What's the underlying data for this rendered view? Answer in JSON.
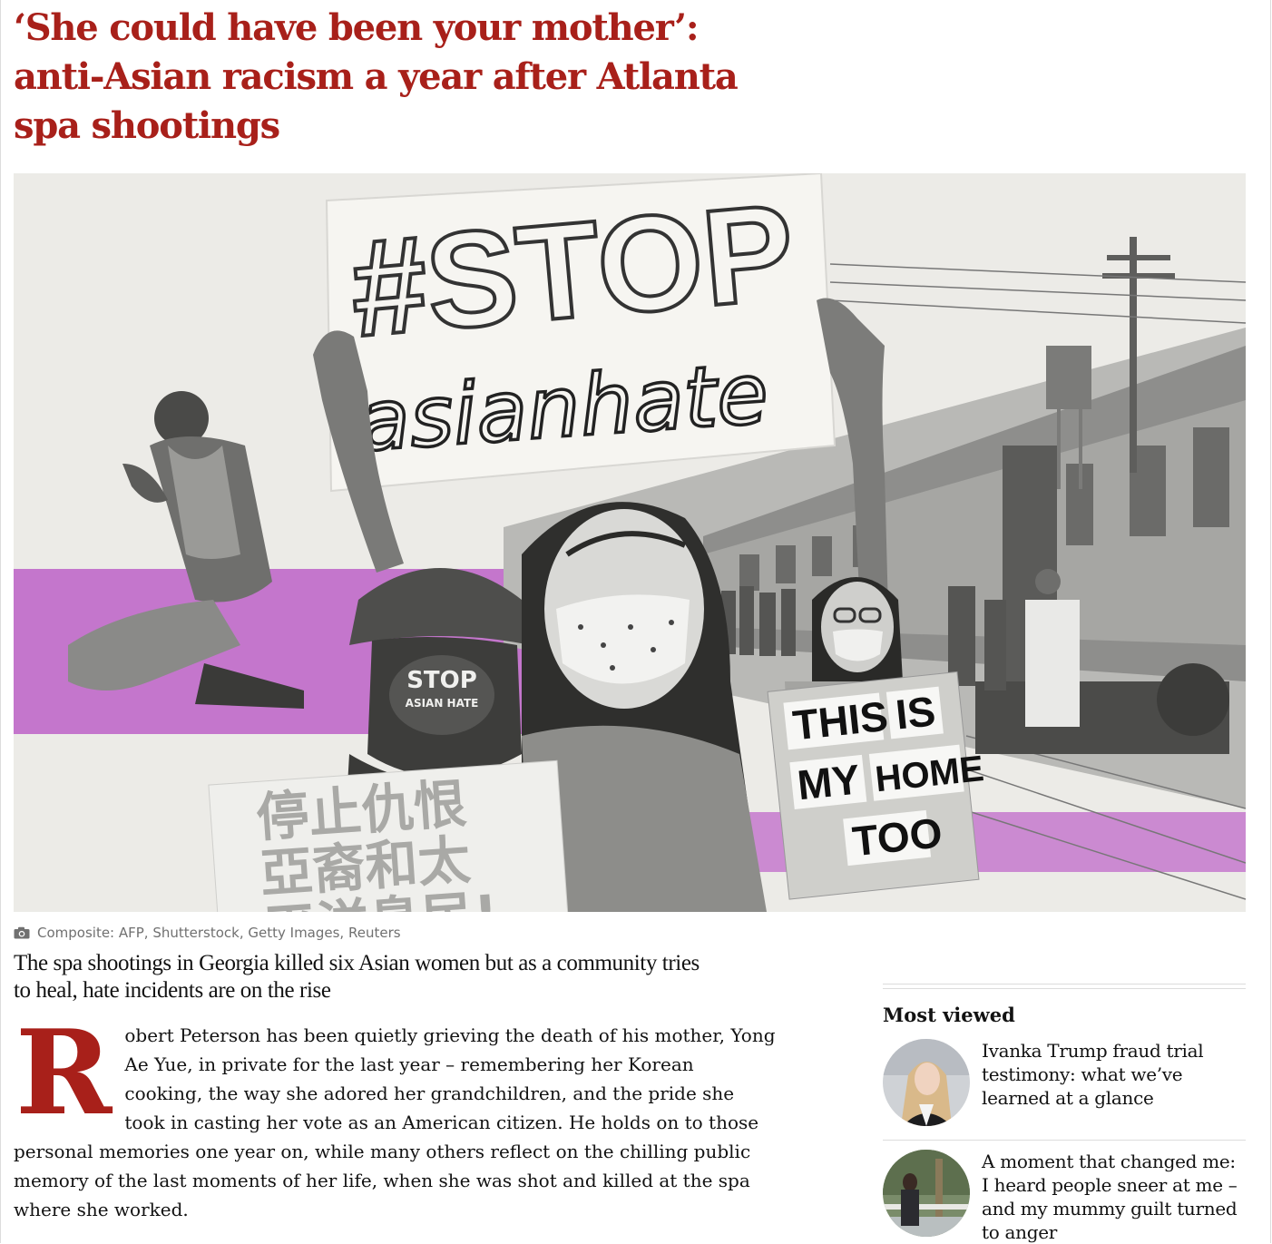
{
  "article": {
    "headline": "‘She could have been your mother’: anti-Asian racism a year after Atlanta spa shootings",
    "image_caption": "Composite: AFP, Shutterstock, Getty Images, Reuters",
    "standfirst": "The spa shootings in Georgia killed six Asian women but as a community tries to heal, hate incidents are on the rise",
    "drop_cap": "R",
    "first_paragraph": "obert Peterson has been quietly grieving the death of his mother, Yong Ae Yue, in private for the last year – remembering her Korean cooking, the way she adored her grandchildren, and the pride she took in casting her vote as an American citizen. He holds on to those personal memories one year on, while many others reflect on the chilling public memory of the last moments of her life, when she was shot and killed at the spa where she worked."
  },
  "hero_image": {
    "sign_top_line1": "#STOP",
    "sign_top_line2": "asianhate",
    "mask_line1": "STOP",
    "mask_line2": "ASIAN HATE",
    "sign_chinese_line1": "停止仇恨",
    "sign_chinese_line2": "亞裔和太",
    "sign_chinese_line3": "平洋島民!",
    "sign_right_words": [
      "THIS",
      "IS",
      "MY",
      "HOME",
      "TOO"
    ]
  },
  "most_viewed": {
    "title": "Most viewed",
    "items": [
      {
        "title": "Ivanka Trump fraud trial testimony: what we’ve learned at a glance"
      },
      {
        "title": "A moment that changed me: I heard people sneer at me – and my mummy guilt turned to anger"
      }
    ]
  },
  "colors": {
    "headline_red": "#a8201a",
    "caption_grey": "#707070",
    "rule_grey": "#dcdcdc",
    "hero_purple": "#c069c9"
  },
  "icons": [
    "camera-icon"
  ]
}
